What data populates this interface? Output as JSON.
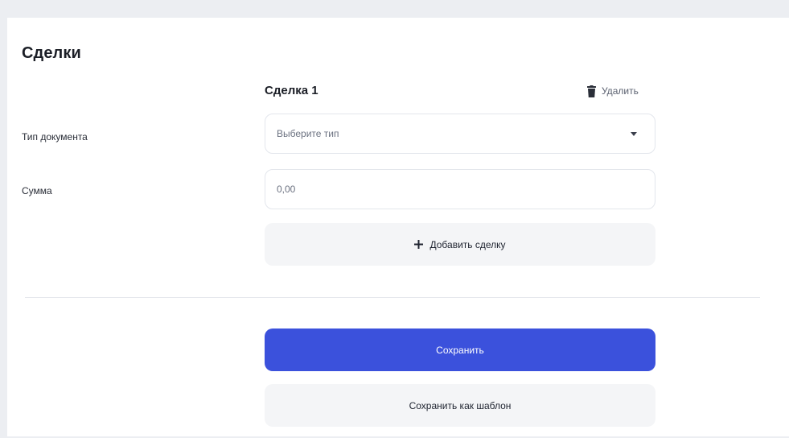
{
  "section": {
    "title": "Сделки"
  },
  "deal": {
    "title": "Сделка 1",
    "delete_label": "Удалить",
    "delete_icon": "trash-icon"
  },
  "fields": {
    "document_type": {
      "label": "Тип документа",
      "placeholder": "Выберите тип",
      "icon": "caret-down-icon"
    },
    "amount": {
      "label": "Сумма",
      "placeholder": "0,00"
    }
  },
  "actions": {
    "add_deal_label": "Добавить сделку",
    "add_deal_icon": "plus-icon",
    "save_label": "Сохранить",
    "save_as_template_label": "Сохранить как шаблон"
  },
  "colors": {
    "primary": "#3b51dc",
    "secondary_button": "#f4f5f7",
    "background": "#eceef2"
  }
}
